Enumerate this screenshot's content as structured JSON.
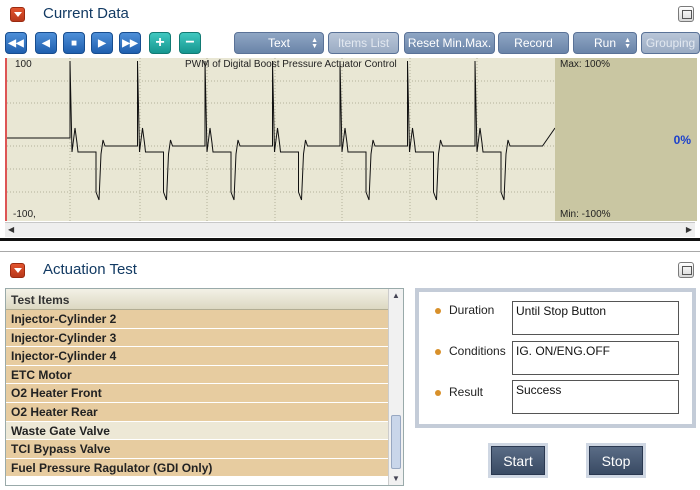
{
  "current_data": {
    "title": "Current Data",
    "toolbar": {
      "nav_buttons": [
        "rewind-icon",
        "step-back-icon",
        "stop-icon",
        "play-icon",
        "fast-forward-icon"
      ],
      "zoom_in": "+",
      "zoom_out": "−",
      "text_label": "Text",
      "items_list_label": "Items List",
      "reset_label": "Reset Min.Max.",
      "record_label": "Record",
      "run_label": "Run",
      "grouping_label": "Grouping"
    },
    "graph": {
      "title": "PWM of Digital Boost Pressure Actuator Control",
      "y_top": "100",
      "y_bottom": "-100,",
      "max_label": "Max:  100%",
      "min_label": "Min:  -100%",
      "current_value": "0%"
    }
  },
  "actuation_test": {
    "title": "Actuation Test",
    "list_header": "Test Items",
    "items": [
      "Injector-Cylinder 2",
      "Injector-Cylinder 3",
      "Injector-Cylinder 4",
      "ETC Motor",
      "O2 Heater Front",
      "O2 Heater Rear",
      "Waste Gate Valve",
      "TCI Bypass Valve",
      "Fuel Pressure Ragulator (GDI Only)"
    ],
    "selected_item": "Waste Gate Valve",
    "details": {
      "duration_label": "Duration",
      "duration_value": "Until Stop Button",
      "conditions_label": "Conditions",
      "conditions_value": "IG. ON/ENG.OFF",
      "result_label": "Result",
      "result_value": "Success"
    },
    "start_label": "Start",
    "stop_label": "Stop"
  },
  "colors": {
    "accent_blue": "#1f5fae",
    "list_row": "#e7cca0",
    "graph_bg": "#e9e7d4",
    "percent_text": "#1a3fcc"
  }
}
